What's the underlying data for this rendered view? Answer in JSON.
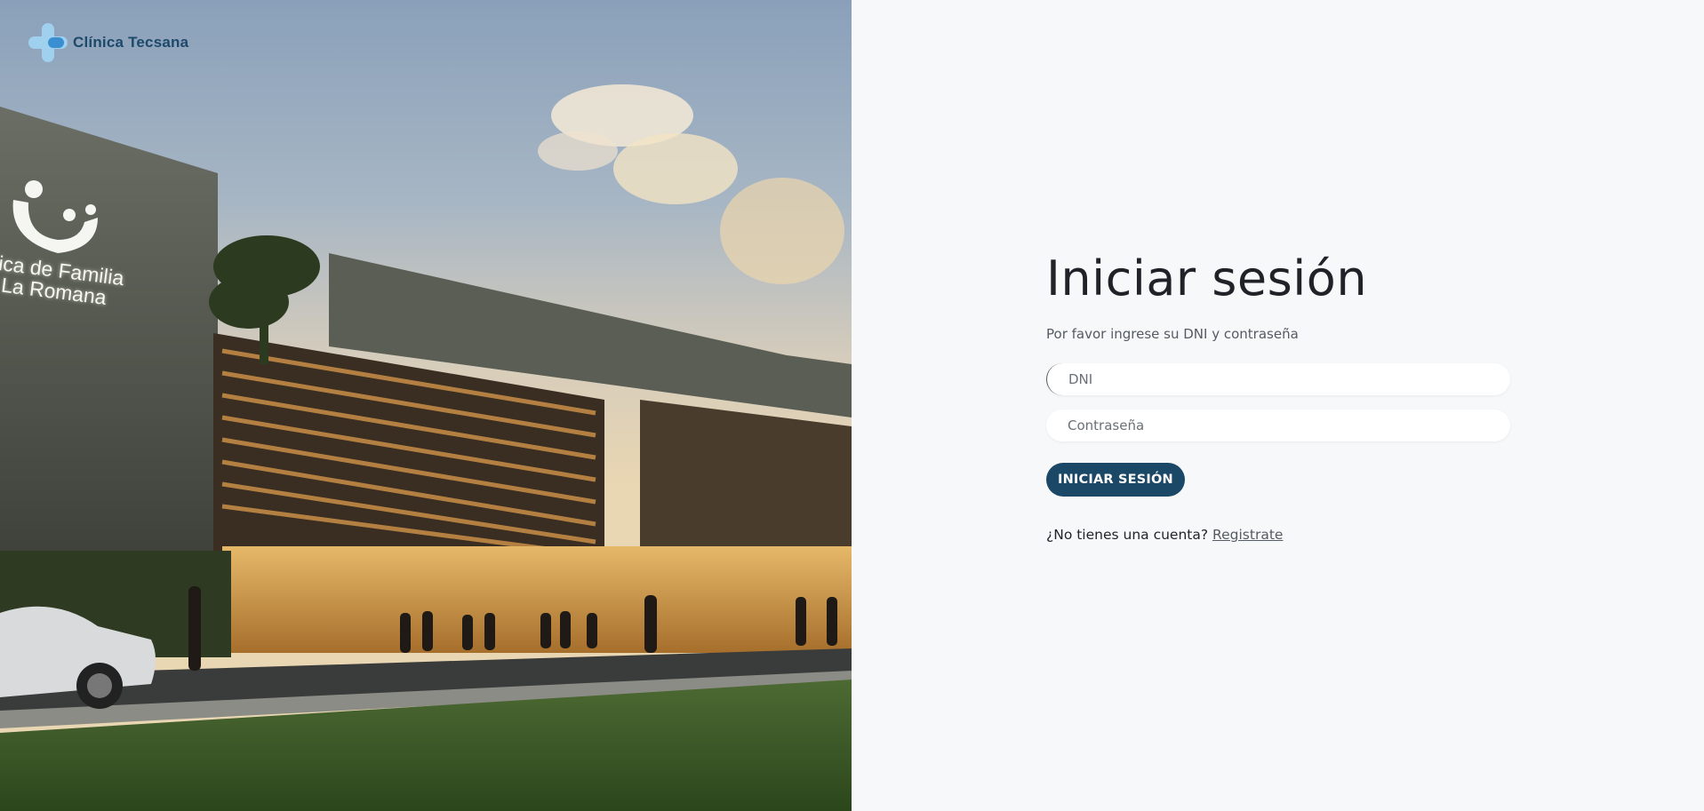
{
  "brand": {
    "name": "Clínica Tecsana"
  },
  "hero": {
    "sign_line1": "ica de Familia",
    "sign_line2": "La Romana"
  },
  "login": {
    "title": "Iniciar sesión",
    "subtitle": "Por favor ingrese su DNI y contraseña",
    "dni_placeholder": "DNI",
    "password_placeholder": "Contraseña",
    "submit_label": "INICIAR SESIÓN",
    "no_account_text": "¿No tienes una cuenta?",
    "register_link": "Registrate"
  },
  "colors": {
    "brand": "#1d4a6b",
    "button": "#1b4866",
    "panel_bg": "#f7f8fa"
  }
}
